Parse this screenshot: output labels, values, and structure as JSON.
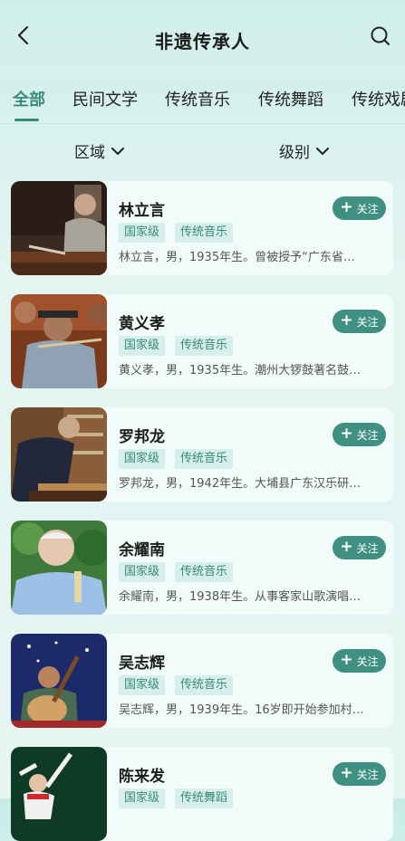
{
  "header": {
    "title": "非遗传承人",
    "back_icon": "back-chevron-icon",
    "search_icon": "search-icon"
  },
  "tabs": [
    {
      "label": "全部",
      "active": true
    },
    {
      "label": "民间文学",
      "active": false
    },
    {
      "label": "传统音乐",
      "active": false
    },
    {
      "label": "传统舞蹈",
      "active": false
    },
    {
      "label": "传统戏剧",
      "active": false
    }
  ],
  "filters": {
    "region": "区域",
    "level": "级别"
  },
  "follow_label": "关注",
  "people": [
    {
      "name": "林立言",
      "level": "国家级",
      "category": "传统音乐",
      "desc": "林立言，男，1935年生。曾被授予“广东省…"
    },
    {
      "name": "黄义孝",
      "level": "国家级",
      "category": "传统音乐",
      "desc": "黄义孝，男，1935年生。潮州大锣鼓著名鼓…"
    },
    {
      "name": "罗邦龙",
      "level": "国家级",
      "category": "传统音乐",
      "desc": "罗邦龙，男，1942年生。大埔县广东汉乐研…"
    },
    {
      "name": "余耀南",
      "level": "国家级",
      "category": "传统音乐",
      "desc": "余耀南，男，1938年生。从事客家山歌演唱…"
    },
    {
      "name": "吴志辉",
      "level": "国家级",
      "category": "传统音乐",
      "desc": "吴志辉，男，1939年生。16岁即开始参加村…"
    },
    {
      "name": "陈来发",
      "level": "国家级",
      "category": "传统舞蹈",
      "desc": ""
    }
  ],
  "colors": {
    "accent": "#3a8a7c",
    "tag_bg": "#d6efea",
    "card_bg": "#f1fbf9",
    "follow_bg": "#3f8f82"
  }
}
